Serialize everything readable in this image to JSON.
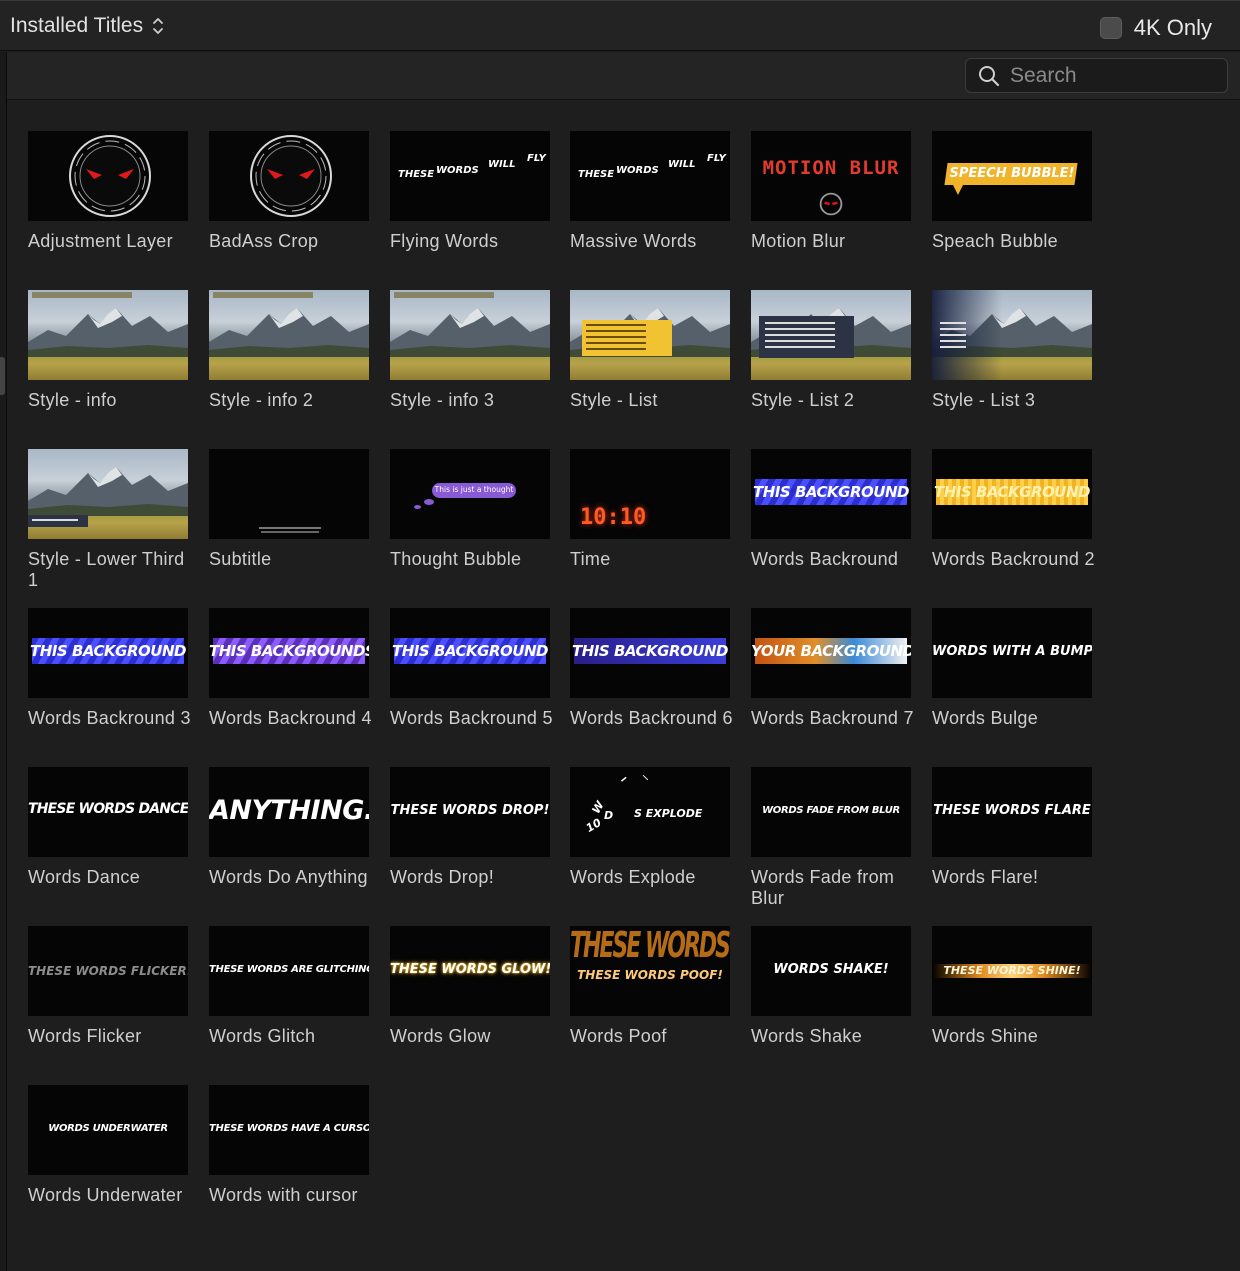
{
  "header": {
    "title": "Installed Titles",
    "fourk_label": "4K Only"
  },
  "search": {
    "placeholder": "Search"
  },
  "tiles": [
    {
      "label": "Adjustment Layer",
      "thumb": "mask",
      "text": ""
    },
    {
      "label": "BadAss Crop",
      "thumb": "mask",
      "text": ""
    },
    {
      "label": "Flying Words",
      "thumb": "flying",
      "text": ""
    },
    {
      "label": "Massive Words",
      "thumb": "flying",
      "text": ""
    },
    {
      "label": "Motion Blur",
      "thumb": "motionblur",
      "text": "MOTION BLUR"
    },
    {
      "label": "Speach Bubble",
      "thumb": "speech",
      "text": "SPEECH BUBBLE!"
    },
    {
      "label": "Style - info",
      "thumb": "landscape",
      "text": ""
    },
    {
      "label": "Style - info 2",
      "thumb": "landscape",
      "text": ""
    },
    {
      "label": "Style - info 3",
      "thumb": "landscape",
      "text": ""
    },
    {
      "label": "Style - List",
      "thumb": "landscape-list-yellow",
      "text": ""
    },
    {
      "label": "Style - List 2",
      "thumb": "landscape-list-dark",
      "text": ""
    },
    {
      "label": "Style - List 3",
      "thumb": "landscape-list-fade",
      "text": ""
    },
    {
      "label": "Style - Lower Third 1",
      "thumb": "landscape-lower",
      "text": ""
    },
    {
      "label": "Subtitle",
      "thumb": "subtitle",
      "text": ""
    },
    {
      "label": "Thought Bubble",
      "thumb": "thought",
      "text": "This is just a thought"
    },
    {
      "label": "Time",
      "thumb": "time",
      "text": "10:10"
    },
    {
      "label": "Words Backround",
      "thumb": "bg-blue",
      "text": "THIS BACKGROUND"
    },
    {
      "label": "Words Backround 2",
      "thumb": "bg-yellow",
      "text": "THIS BACKGROUND"
    },
    {
      "label": "Words Backround 3",
      "thumb": "bg-blue",
      "text": "THIS BACKGROUND"
    },
    {
      "label": "Words Backround 4",
      "thumb": "bg-purple",
      "text": "THIS BACKGROUNDS"
    },
    {
      "label": "Words Backround 5",
      "thumb": "bg-blue",
      "text": "THIS BACKGROUND"
    },
    {
      "label": "Words Backround 6",
      "thumb": "bg-blue-dark",
      "text": "THIS BACKGROUND"
    },
    {
      "label": "Words Backround 7",
      "thumb": "bg-fire",
      "text": "YOUR BACKGROUND"
    },
    {
      "label": "Words Bulge",
      "thumb": "plain",
      "text": "WORDS WITH A BUMP"
    },
    {
      "label": "Words Dance",
      "thumb": "plain-lg",
      "text": "THESE WORDS DANCE!"
    },
    {
      "label": "Words Do Anything",
      "thumb": "plain-xl",
      "text": "ANYTHING."
    },
    {
      "label": "Words Drop!",
      "thumb": "plain",
      "text": "THESE WORDS DROP!"
    },
    {
      "label": "Words Explode",
      "thumb": "explode",
      "text": "S EXPLODE"
    },
    {
      "label": "Words Fade from Blur",
      "thumb": "plain-sm",
      "text": "WORDS FADE FROM BLUR"
    },
    {
      "label": "Words Flare!",
      "thumb": "plain",
      "text": "THESE WORDS FLARE"
    },
    {
      "label": "Words Flicker",
      "thumb": "flicker",
      "text": "THESE WORDS FLICKER!"
    },
    {
      "label": "Words Glitch",
      "thumb": "plain-sm",
      "text": "THESE WORDS ARE GLITCHING!"
    },
    {
      "label": "Words Glow",
      "thumb": "glow",
      "text": "THESE WORDS GLOW!"
    },
    {
      "label": "Words Poof",
      "thumb": "poof",
      "text": "THESE WORDS POOF!"
    },
    {
      "label": "Words Shake",
      "thumb": "plain",
      "text": "WORDS SHAKE!"
    },
    {
      "label": "Words Shine",
      "thumb": "shine",
      "text": "THESE WORDS SHINE!"
    },
    {
      "label": "Words Underwater",
      "thumb": "plain-sm",
      "text": "WORDS UNDERWATER"
    },
    {
      "label": "Words with cursor",
      "thumb": "plain-sm",
      "text": "THESE WORDS HAVE A CURSOR"
    }
  ]
}
